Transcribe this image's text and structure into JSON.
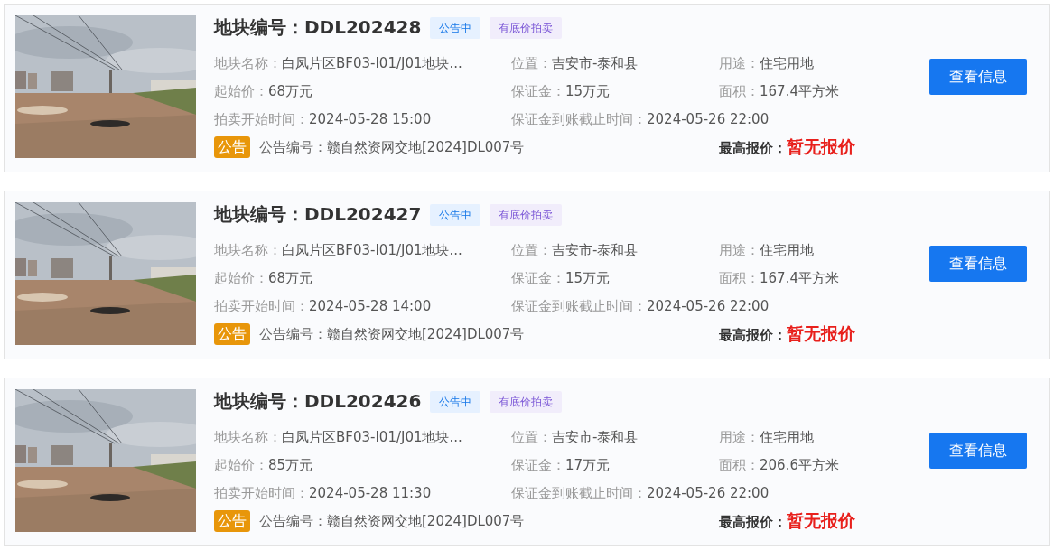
{
  "listings": [
    {
      "title": "地块编号：DDL202428",
      "tags": [
        {
          "kind": "status",
          "text": "公告中"
        },
        {
          "kind": "type",
          "text": "有底价拍卖"
        }
      ],
      "fields": [
        {
          "label": "地块名称：",
          "value": "白凤片区BF03-I01/J01地块..."
        },
        {
          "label": "位置：",
          "value": "吉安市-泰和县"
        },
        {
          "label": "用途：",
          "value": "住宅用地"
        },
        {
          "label": "起始价：",
          "value": "68万元"
        },
        {
          "label": "保证金：",
          "value": "15万元"
        },
        {
          "label": "面积：",
          "value": "167.4平方米"
        },
        {
          "label": "拍卖开始时间：",
          "value": "2024-05-28 15:00"
        },
        {
          "label": "保证金到账截止时间：",
          "value": "2024-05-26 22:00"
        }
      ],
      "notice_badge": "公告",
      "notice_label": "公告编号：",
      "notice_value": "赣自然资网交地[2024]DL007号",
      "bid_label": "最高报价：",
      "bid_value": "暂无报价",
      "button": "查看信息"
    },
    {
      "title": "地块编号：DDL202427",
      "tags": [
        {
          "kind": "status",
          "text": "公告中"
        },
        {
          "kind": "type",
          "text": "有底价拍卖"
        }
      ],
      "fields": [
        {
          "label": "地块名称：",
          "value": "白凤片区BF03-I01/J01地块..."
        },
        {
          "label": "位置：",
          "value": "吉安市-泰和县"
        },
        {
          "label": "用途：",
          "value": "住宅用地"
        },
        {
          "label": "起始价：",
          "value": "68万元"
        },
        {
          "label": "保证金：",
          "value": "15万元"
        },
        {
          "label": "面积：",
          "value": "167.4平方米"
        },
        {
          "label": "拍卖开始时间：",
          "value": "2024-05-28 14:00"
        },
        {
          "label": "保证金到账截止时间：",
          "value": "2024-05-26 22:00"
        }
      ],
      "notice_badge": "公告",
      "notice_label": "公告编号：",
      "notice_value": "赣自然资网交地[2024]DL007号",
      "bid_label": "最高报价：",
      "bid_value": "暂无报价",
      "button": "查看信息"
    },
    {
      "title": "地块编号：DDL202426",
      "tags": [
        {
          "kind": "status",
          "text": "公告中"
        },
        {
          "kind": "type",
          "text": "有底价拍卖"
        }
      ],
      "fields": [
        {
          "label": "地块名称：",
          "value": "白凤片区BF03-I01/J01地块..."
        },
        {
          "label": "位置：",
          "value": "吉安市-泰和县"
        },
        {
          "label": "用途：",
          "value": "住宅用地"
        },
        {
          "label": "起始价：",
          "value": "85万元"
        },
        {
          "label": "保证金：",
          "value": "17万元"
        },
        {
          "label": "面积：",
          "value": "206.6平方米"
        },
        {
          "label": "拍卖开始时间：",
          "value": "2024-05-28 11:30"
        },
        {
          "label": "保证金到账截止时间：",
          "value": "2024-05-26 22:00"
        }
      ],
      "notice_badge": "公告",
      "notice_label": "公告编号：",
      "notice_value": "赣自然资网交地[2024]DL007号",
      "bid_label": "最高报价：",
      "bid_value": "暂无报价",
      "button": "查看信息"
    }
  ]
}
